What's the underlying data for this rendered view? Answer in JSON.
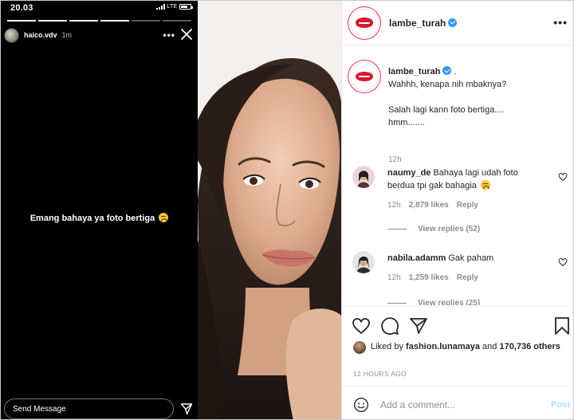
{
  "story": {
    "status_time": "20.03",
    "network": "LTE",
    "username": "haico.vdv",
    "time_ago": "1m",
    "text": "Emang bahaya ya foto bertiga",
    "send_placeholder": "Send Message"
  },
  "post": {
    "account": "lambe_turah",
    "caption": {
      "username": "lambe_turah",
      "suffix": ".",
      "line1": "Wahhh, kenapa nih mbaknya?",
      "line2": "Salah lagi kann foto bertiga....",
      "line3": "hmm.......",
      "time": "12h"
    },
    "comments": [
      {
        "username": "naumy_de",
        "text": "Bahaya lagi udah foto berdua tpi gak bahagia",
        "time": "12h",
        "likes": "2,879 likes",
        "reply": "Reply",
        "view_replies": "View replies (52)"
      },
      {
        "username": "nabila.adamm",
        "text": "Gak paham",
        "time": "12h",
        "likes": "1,259 likes",
        "reply": "Reply",
        "view_replies": "View replies (25)"
      }
    ],
    "liked_by_prefix": "Liked by",
    "liked_by_user": "fashion.lunamaya",
    "liked_by_and": "and",
    "liked_by_count": "170,736 others",
    "timestamp": "12 HOURS AGO",
    "comment_placeholder": "Add a comment...",
    "post_button": "Post"
  },
  "colors": {
    "verified": "#3897f0",
    "brand_red": "#d7192e",
    "post_button_disabled": "#b2dffc"
  }
}
